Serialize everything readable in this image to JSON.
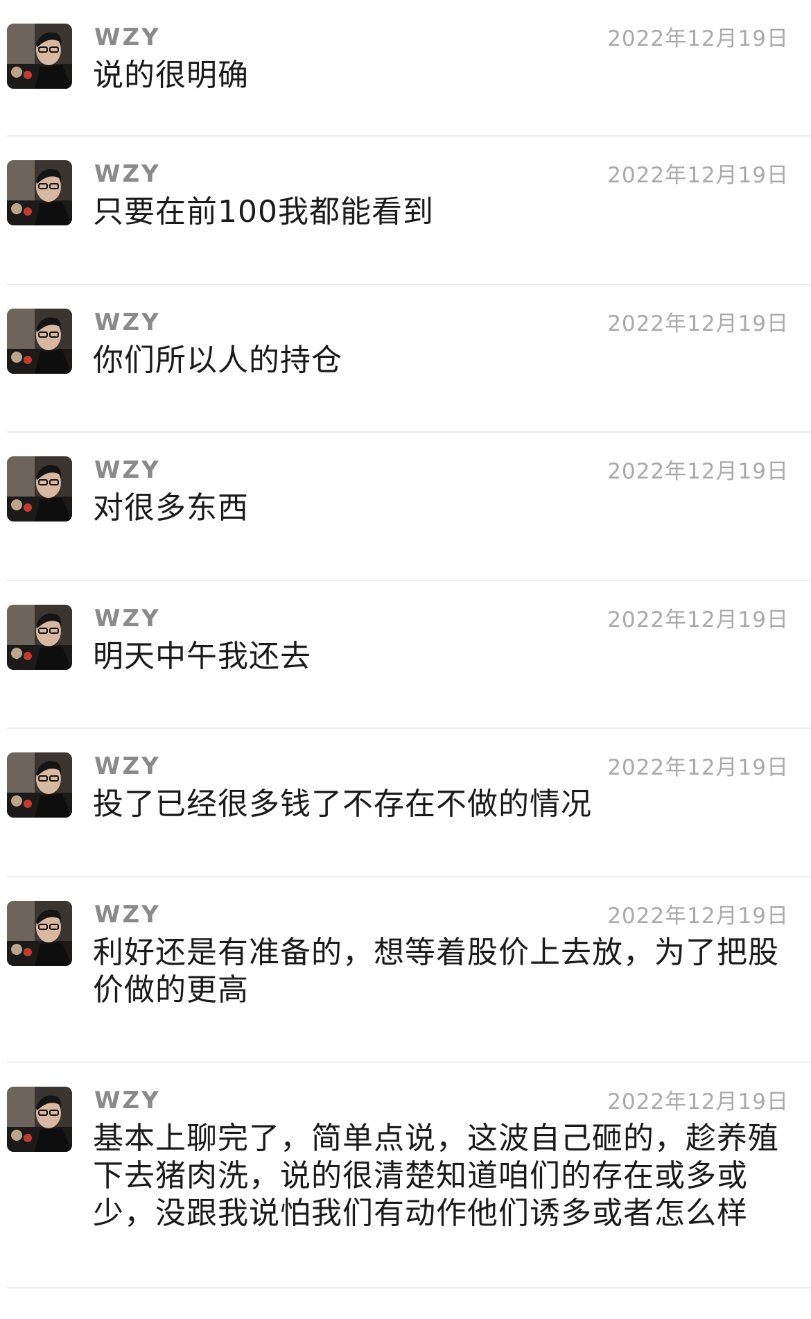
{
  "messages": [
    {
      "sender": "WZY",
      "date": "2022年12月19日",
      "text": "说的很明确"
    },
    {
      "sender": "WZY",
      "date": "2022年12月19日",
      "text": "只要在前100我都能看到"
    },
    {
      "sender": "WZY",
      "date": "2022年12月19日",
      "text": "你们所以人的持仓"
    },
    {
      "sender": "WZY",
      "date": "2022年12月19日",
      "text": "对很多东西"
    },
    {
      "sender": "WZY",
      "date": "2022年12月19日",
      "text": "明天中午我还去"
    },
    {
      "sender": "WZY",
      "date": "2022年12月19日",
      "text": "投了已经很多钱了不存在不做的情况"
    },
    {
      "sender": "WZY",
      "date": "2022年12月19日",
      "text": "利好还是有准备的，想等着股价上去放，为了把股价做的更高"
    },
    {
      "sender": "WZY",
      "date": "2022年12月19日",
      "text": "基本上聊完了，简单点说，这波自己砸的，趁养殖下去猪肉洗，说的很清楚知道咱们的存在或多或少，没跟我说怕我们有动作他们诱多或者怎么样"
    }
  ],
  "colors": {
    "name": "#8a8a8a",
    "date": "#a9a9a9",
    "message": "#1a1a1a",
    "divider": "#ececec"
  },
  "icons": {
    "avatar": "user-avatar-photo-icon"
  }
}
